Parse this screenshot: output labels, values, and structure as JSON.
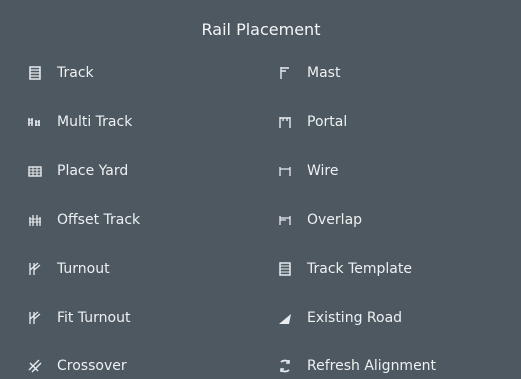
{
  "panel": {
    "title": "Rail Placement",
    "left_items": [
      {
        "label": "Track",
        "icon": "track-icon"
      },
      {
        "label": "Multi Track",
        "icon": "multi-track-icon"
      },
      {
        "label": "Place Yard",
        "icon": "place-yard-icon"
      },
      {
        "label": "Offset Track",
        "icon": "offset-track-icon"
      },
      {
        "label": "Turnout",
        "icon": "turnout-icon"
      },
      {
        "label": "Fit Turnout",
        "icon": "fit-turnout-icon"
      },
      {
        "label": "Crossover",
        "icon": "crossover-icon"
      }
    ],
    "right_items": [
      {
        "label": "Mast",
        "icon": "mast-icon"
      },
      {
        "label": "Portal",
        "icon": "portal-icon"
      },
      {
        "label": "Wire",
        "icon": "wire-icon"
      },
      {
        "label": "Overlap",
        "icon": "overlap-icon"
      },
      {
        "label": "Track Template",
        "icon": "track-template-icon"
      },
      {
        "label": "Existing Road",
        "icon": "existing-road-icon"
      },
      {
        "label": "Refresh Alignment",
        "icon": "refresh-alignment-icon"
      }
    ]
  },
  "colors": {
    "background": "#4d5860",
    "text": "#eef1f2"
  }
}
